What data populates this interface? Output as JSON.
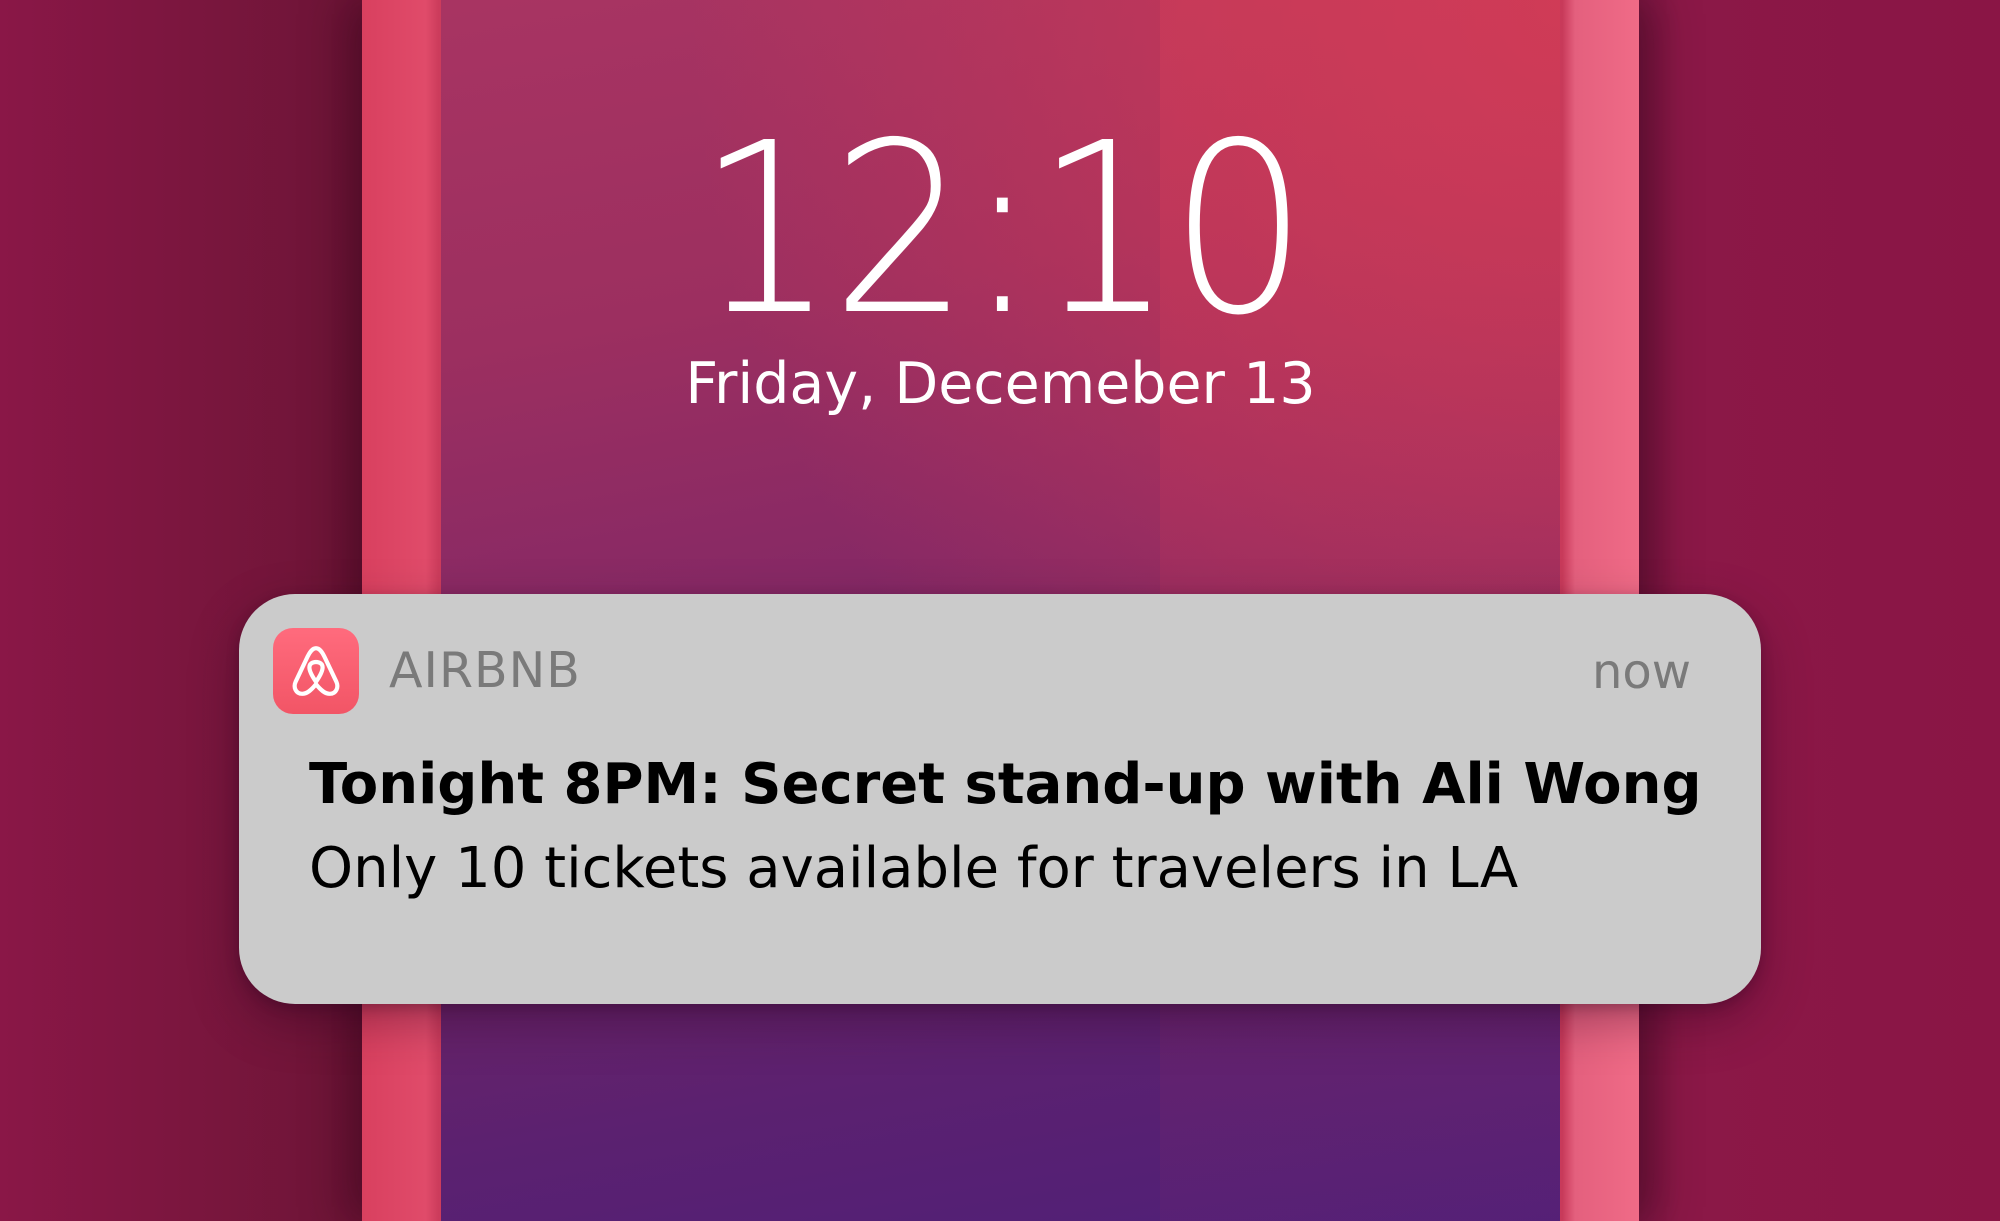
{
  "lockscreen": {
    "time": "12:10",
    "date": "Friday, Decemeber 13"
  },
  "notification": {
    "app_icon": "airbnb-logo-icon",
    "app_name": "AIRBNB",
    "time_ago": "now",
    "title": "Tonight 8PM: Secret stand-up with Ali Wong",
    "body": "Only 10 tickets available for travelers in LA"
  },
  "colors": {
    "brand": "#ff5a5f",
    "notification_bg": "#cbcbcb",
    "background": "#7e1743"
  }
}
